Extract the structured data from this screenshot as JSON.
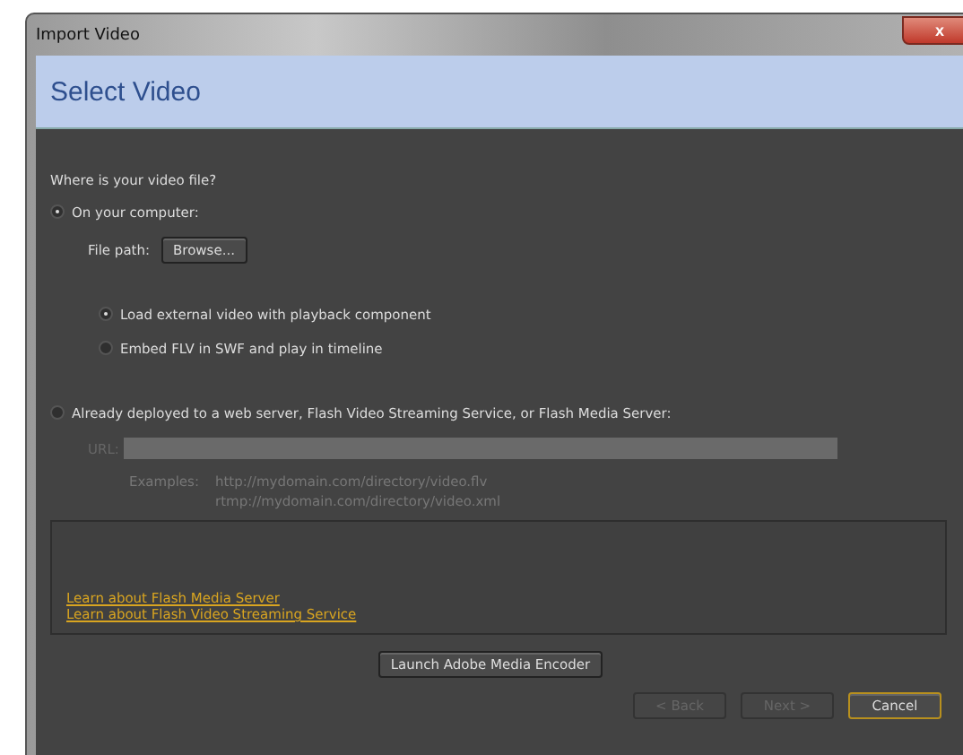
{
  "window": {
    "title": "Import Video",
    "close": "x"
  },
  "header": {
    "title": "Select Video"
  },
  "question": "Where is your video file?",
  "source_options": [
    {
      "label": "On your computer:",
      "selected": true
    },
    {
      "label": "Already deployed to a web server, Flash Video Streaming Service, or Flash Media Server:",
      "selected": false
    }
  ],
  "file_path": {
    "label": "File path:",
    "button": "Browse..."
  },
  "playback_options": [
    {
      "label": "Load external video with playback component",
      "selected": true
    },
    {
      "label": "Embed FLV in SWF and play in timeline",
      "selected": false
    }
  ],
  "url": {
    "label": "URL:",
    "disabled": true
  },
  "examples": {
    "label": "Examples:",
    "lines": [
      "http://mydomain.com/directory/video.flv",
      "rtmp://mydomain.com/directory/video.xml"
    ]
  },
  "links": [
    "Learn about Flash Media Server",
    "Learn about Flash Video Streaming Service"
  ],
  "launch_button": "Launch Adobe Media Encoder",
  "buttons": [
    {
      "label": "< Back",
      "disabled": true,
      "default": false
    },
    {
      "label": "Next >",
      "disabled": true,
      "default": false
    },
    {
      "label": "Cancel",
      "disabled": false,
      "default": true
    }
  ]
}
